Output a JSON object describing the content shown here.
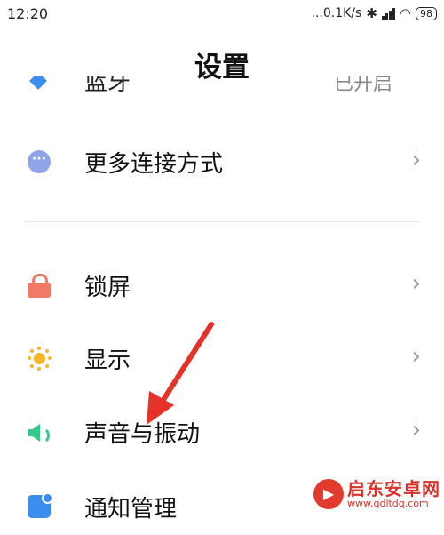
{
  "status_bar": {
    "time": "12:20",
    "network_speed": "...0.1K/s",
    "battery": "98"
  },
  "page": {
    "title": "设置"
  },
  "partial_row": {
    "label": "蓝牙",
    "value": "已开启"
  },
  "settings_items": [
    {
      "label": "更多连接方式",
      "icon": "more-icon"
    },
    {
      "label": "锁屏",
      "icon": "lock-icon"
    },
    {
      "label": "显示",
      "icon": "sun-icon"
    },
    {
      "label": "声音与振动",
      "icon": "speaker-icon"
    },
    {
      "label": "通知管理",
      "icon": "notification-icon"
    }
  ],
  "chevron": "›",
  "watermark": {
    "title": "启东安卓网",
    "url": "www.qdltdq.com"
  },
  "colors": {
    "annotation_arrow": "#e5332a",
    "lock": "#f07a66",
    "sun": "#f7b529",
    "speaker": "#33c989",
    "more": "#8fa5e8",
    "notification": "#3b8ef0"
  }
}
